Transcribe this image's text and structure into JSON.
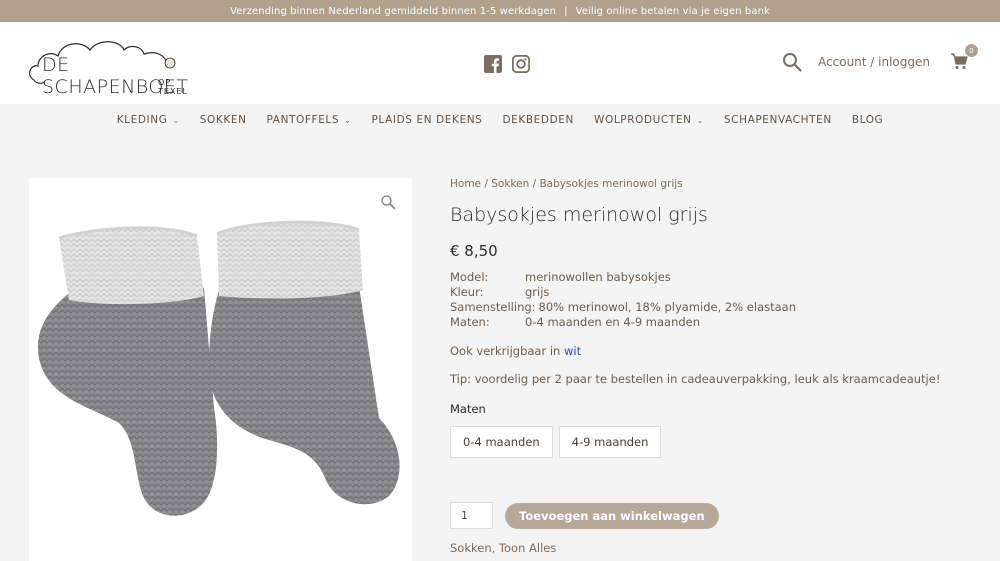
{
  "topbar": {
    "left_text": "Verzending binnen Nederland gemiddeld binnen 1-5 werkdagen",
    "separator": "|",
    "right_text": "Veilig online betalen via je eigen bank"
  },
  "header": {
    "logo_text": "DE SCHAPENBOET",
    "logo_sub": "OP TEXEL",
    "social_icons": [
      "facebook-icon",
      "instagram-icon"
    ],
    "account_label": "Account / inloggen",
    "cart_count": "0"
  },
  "nav": {
    "items": [
      {
        "label": "KLEDING",
        "dropdown": true
      },
      {
        "label": "SOKKEN",
        "dropdown": false
      },
      {
        "label": "PANTOFFELS",
        "dropdown": true
      },
      {
        "label": "PLAIDS EN DEKENS",
        "dropdown": false
      },
      {
        "label": "DEKBEDDEN",
        "dropdown": false
      },
      {
        "label": "WOLPRODUCTEN",
        "dropdown": true
      },
      {
        "label": "SCHAPENVACHTEN",
        "dropdown": false
      },
      {
        "label": "BLOG",
        "dropdown": false
      }
    ]
  },
  "breadcrumb": {
    "home": "Home",
    "sep1": " / ",
    "category": "Sokken",
    "sep2": " / ",
    "current": "Babysokjes merinowol grijs"
  },
  "product": {
    "title": "Babysokjes merinowol grijs",
    "price": "€ 8,50",
    "specs": [
      {
        "key": "Model:",
        "value": "merinowollen babysokjes"
      },
      {
        "key": "Kleur:",
        "value": "grijs"
      },
      {
        "key": "Samenstelling:",
        "value": "80% merinowol, 18% plyamide, 2% elastaan"
      },
      {
        "key": "Maten:",
        "value": "0-4 maanden en 4-9 maanden"
      }
    ],
    "alt_prefix": "Ook verkrijgbaar in ",
    "alt_link": "wit",
    "tip": "Tip: voordelig per 2 paar te bestellen in cadeauverpakking, leuk als kraamcadeautje!",
    "sizes_label": "Maten",
    "sizes": [
      "0-4 maanden",
      "4-9 maanden"
    ],
    "quantity": "1",
    "add_to_cart": "Toevoegen aan winkelwagen",
    "categories_link": "Sokken",
    "categories_sep": ", ",
    "categories_all": "Toon Alles"
  },
  "colors": {
    "topbar_bg": "#b0a08c",
    "button_bg": "#b5a898",
    "link_blue": "#2a4bd6"
  }
}
